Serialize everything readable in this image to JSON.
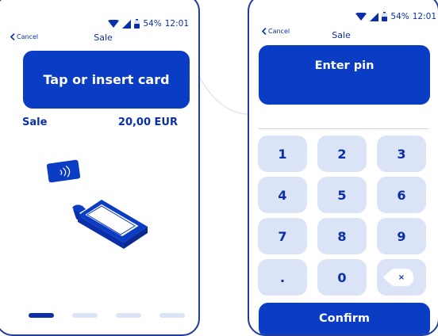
{
  "left_screen": {
    "status": {
      "battery": "54%",
      "time": "12:01"
    },
    "nav": {
      "back_label": "Cancel",
      "title": "Sale"
    },
    "banner_text": "Tap or insert card",
    "sale": {
      "label": "Sale",
      "amount": "20,00 EUR"
    },
    "pager": {
      "pages": 4,
      "active_index": 0
    }
  },
  "right_screen": {
    "status": {
      "battery": "54%",
      "time": "12:01"
    },
    "nav": {
      "back_label": "Cancel",
      "title": "Sale"
    },
    "banner_text": "Enter pin",
    "keypad": {
      "keys": [
        "1",
        "2",
        "3",
        "4",
        "5",
        "6",
        "7",
        "8",
        "9",
        ".",
        "0"
      ],
      "delete_symbol": "×"
    },
    "confirm_label": "Confirm"
  },
  "colors": {
    "primary": "#0b3dc4",
    "text": "#0b2fa8",
    "key_bg": "#dbe3f6",
    "frame": "#1f3c9e"
  }
}
